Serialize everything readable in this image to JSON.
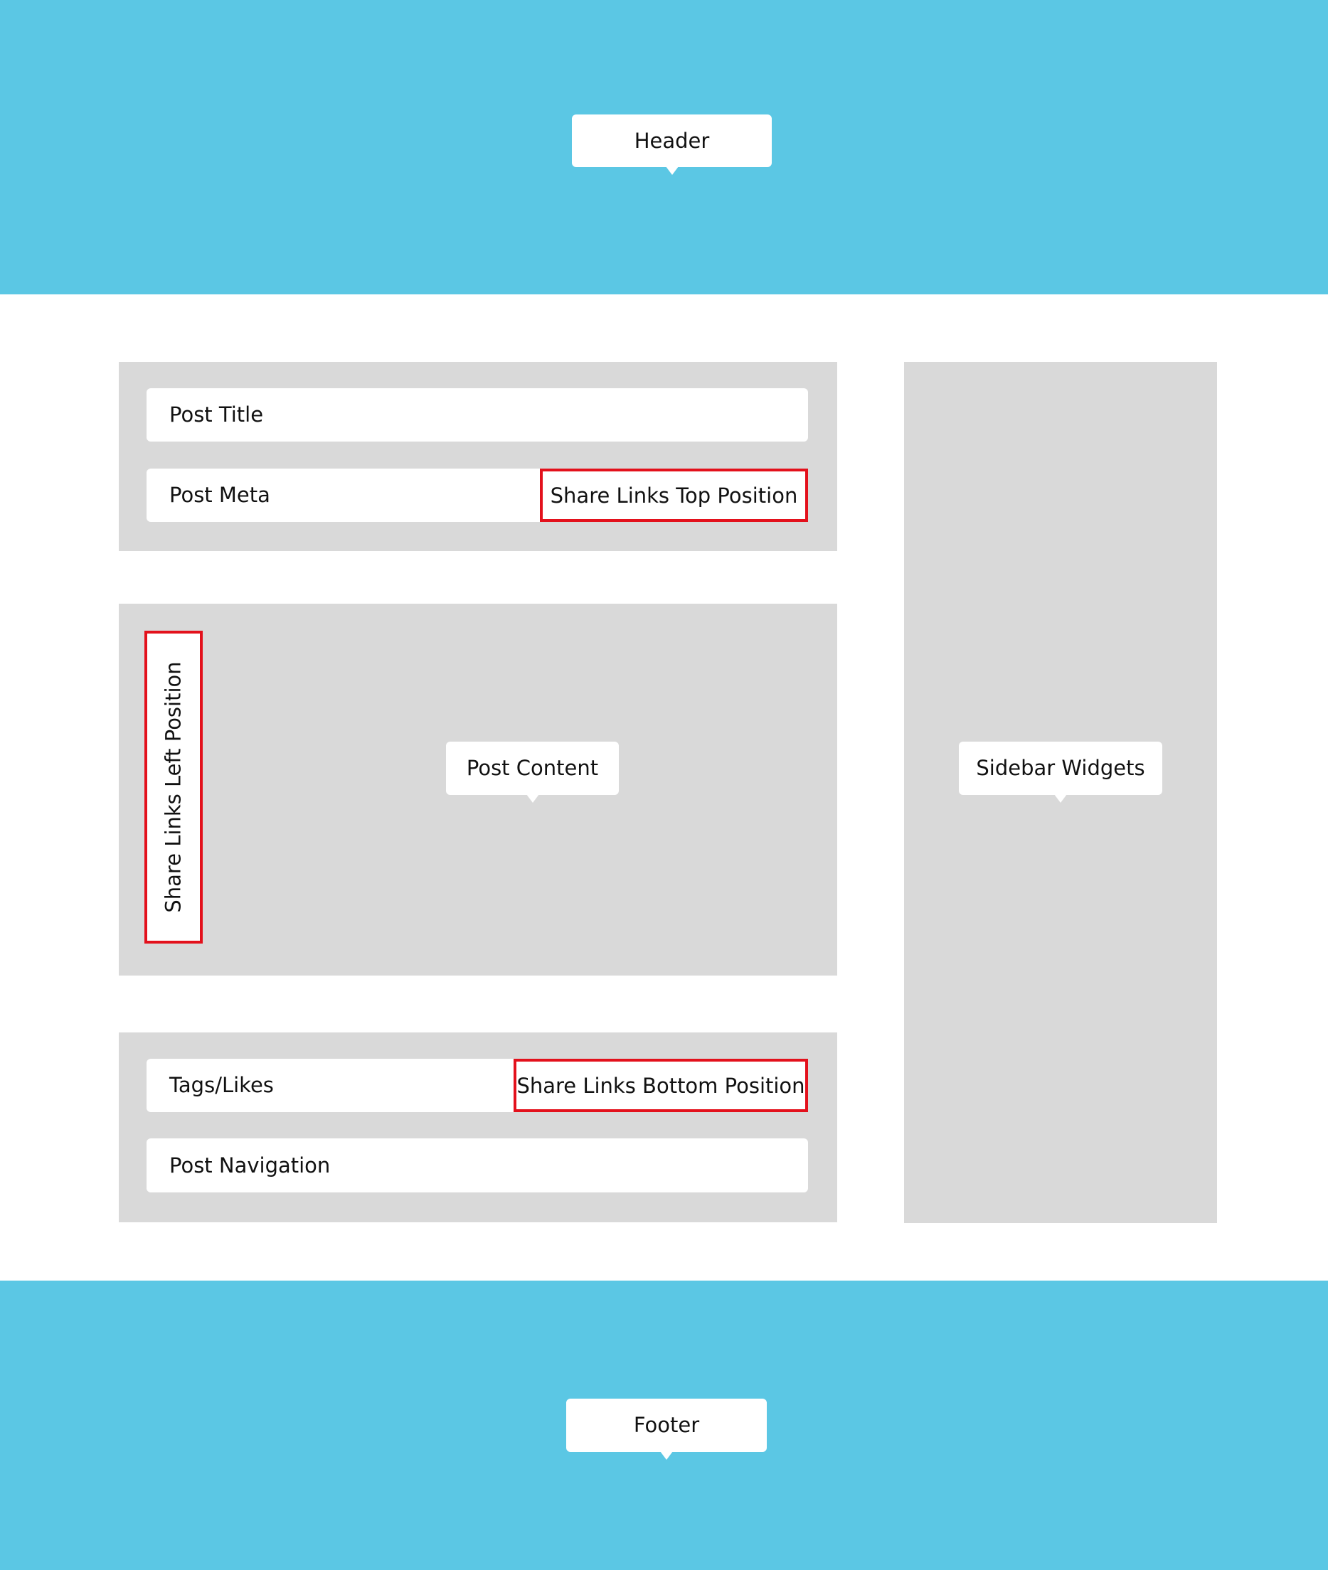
{
  "header": {
    "label": "Header"
  },
  "post_header": {
    "title_label": "Post Title",
    "meta_label": "Post Meta",
    "share_top_label": "Share Links Top Position"
  },
  "post_body": {
    "content_label": "Post Content",
    "share_left_label": "Share Links Left Position"
  },
  "post_footer": {
    "tags_label": "Tags/Likes",
    "share_bottom_label": "Share Links Bottom Position",
    "navigation_label": "Post Navigation"
  },
  "sidebar": {
    "label": "Sidebar Widgets"
  },
  "footer": {
    "label": "Footer"
  },
  "colors": {
    "band": "#5bc7e4",
    "panel": "#d9d9d9",
    "card": "#ffffff",
    "share_outline": "#e3111c"
  }
}
